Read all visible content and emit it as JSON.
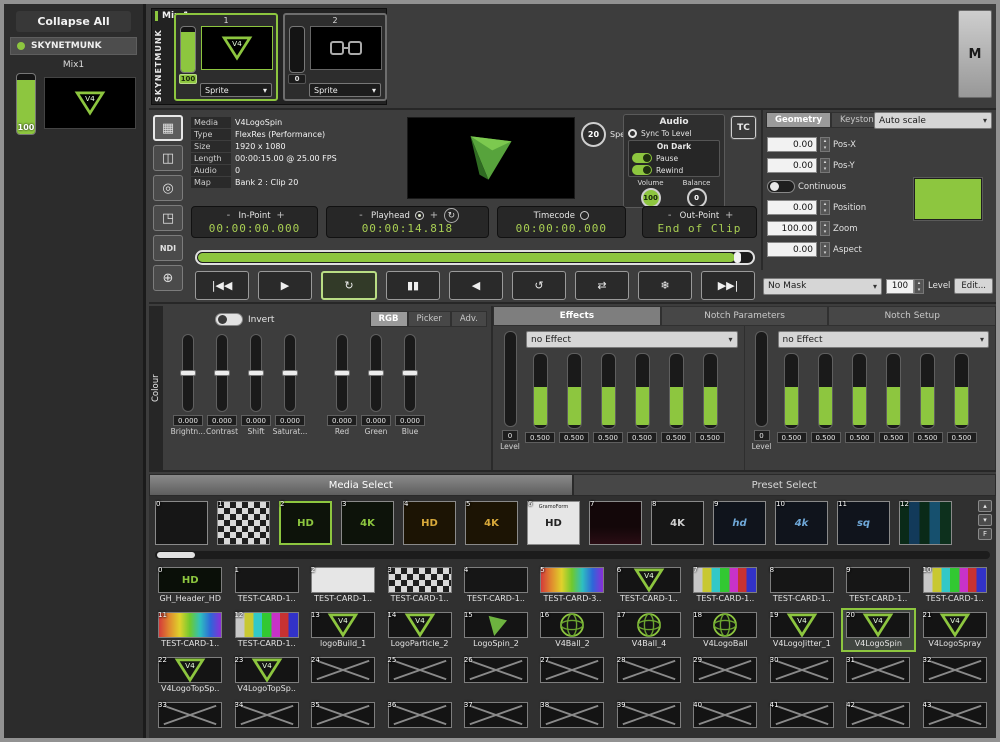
{
  "colors": {
    "accent": "#8dc63f",
    "timecode_text": "#a9cf53"
  },
  "sidebar": {
    "collapse_all": "Collapse All",
    "machine": "SKYNETMUNK",
    "mix": "Mix1",
    "fader": "100"
  },
  "mix_strip": {
    "title": "Mix 1",
    "machine": "SKYNETMUNK",
    "master": "M",
    "layers": [
      {
        "num": "1",
        "fader": "100",
        "type": "Sprite",
        "thumb": "v4",
        "selected": true
      },
      {
        "num": "2",
        "fader": "0",
        "type": "Sprite",
        "thumb": "clip",
        "selected": false
      }
    ]
  },
  "tools": [
    {
      "name": "viewer-grid",
      "glyph": "▦",
      "selected": true
    },
    {
      "name": "camera",
      "glyph": "◫",
      "selected": false
    },
    {
      "name": "record",
      "glyph": "◎",
      "selected": false
    },
    {
      "name": "fullscreen",
      "glyph": "◳",
      "selected": false
    },
    {
      "name": "ndi",
      "glyph": "NDI",
      "selected": false,
      "text": true
    },
    {
      "name": "sphere",
      "glyph": "⊕",
      "selected": false
    }
  ],
  "media_info": {
    "rows": [
      {
        "label": "Media",
        "value": "V4LogoSpin"
      },
      {
        "label": "Type",
        "value": "FlexRes (Performance)"
      },
      {
        "label": "Size",
        "value": "1920 x 1080"
      },
      {
        "label": "Length",
        "value": "00:00:15.00 @ 25.00 FPS"
      },
      {
        "label": "Audio",
        "value": "0"
      },
      {
        "label": "Map",
        "value": "Bank 2 : Clip 20"
      }
    ]
  },
  "playback": {
    "speed_value": "20",
    "speed_label": "Speed",
    "tc": "TC",
    "audio": {
      "title": "Audio",
      "sync": "Sync To Level",
      "on_dark": "On Dark",
      "pause": "Pause",
      "rewind": "Rewind",
      "volume_label": "Volume",
      "balance_label": "Balance",
      "volume": "100",
      "balance": "0"
    },
    "points": [
      {
        "name": "in",
        "label": "In-Point",
        "value": "00:00:00.000",
        "minus": true,
        "plus": true,
        "radio": false,
        "refresh": false
      },
      {
        "name": "playhead",
        "label": "Playhead",
        "value": "00:00:14.818",
        "minus": true,
        "plus": true,
        "radio": true,
        "refresh": true
      },
      {
        "name": "timecode",
        "label": "Timecode",
        "value": "00:00:00.000",
        "minus": false,
        "plus": false,
        "radio": true,
        "refresh": false
      },
      {
        "name": "out",
        "label": "Out-Point",
        "value": "End of Clip",
        "minus": true,
        "plus": true,
        "radio": false,
        "refresh": false
      }
    ],
    "transport": [
      {
        "name": "skip-start",
        "glyph": "|◀◀",
        "selected": false
      },
      {
        "name": "play",
        "glyph": "▶",
        "selected": false
      },
      {
        "name": "loop",
        "glyph": "↻",
        "selected": true
      },
      {
        "name": "pause",
        "glyph": "▮▮",
        "selected": false
      },
      {
        "name": "play-reverse",
        "glyph": "◀",
        "selected": false
      },
      {
        "name": "loop-reverse",
        "glyph": "↺",
        "selected": false
      },
      {
        "name": "bounce",
        "glyph": "⇄",
        "selected": false
      },
      {
        "name": "freeze",
        "glyph": "❄",
        "selected": false
      },
      {
        "name": "skip-end",
        "glyph": "▶▶|",
        "selected": false
      }
    ]
  },
  "geometry": {
    "tabs": [
      {
        "label": "Geometry",
        "active": true
      },
      {
        "label": "Keystone",
        "active": false
      }
    ],
    "scale_mode": "Auto scale",
    "fields": [
      {
        "type": "value",
        "value": "0.00",
        "label": "Pos-X"
      },
      {
        "type": "value",
        "value": "0.00",
        "label": "Pos-Y"
      },
      {
        "type": "toggle",
        "label": "Continuous"
      },
      {
        "type": "value",
        "value": "0.00",
        "label": "Position"
      },
      {
        "type": "value",
        "value": "100.00",
        "label": "Zoom"
      },
      {
        "type": "value",
        "value": "0.00",
        "label": "Aspect"
      }
    ],
    "mask": {
      "value": "No Mask",
      "level": "100",
      "level_label": "Level",
      "edit": "Edit..."
    }
  },
  "colour": {
    "title": "Colour",
    "invert": "Invert",
    "tabs": [
      {
        "label": "RGB",
        "active": true
      },
      {
        "label": "Picker",
        "active": false
      },
      {
        "label": "Adv.",
        "active": false
      }
    ],
    "sliders": [
      {
        "value": "0.000",
        "label": "Brightn..."
      },
      {
        "value": "0.000",
        "label": "Contrast"
      },
      {
        "value": "0.000",
        "label": "Shift"
      },
      {
        "value": "0.000",
        "label": "Saturat..."
      }
    ],
    "rgb": [
      {
        "value": "0.000",
        "label": "Red"
      },
      {
        "value": "0.000",
        "label": "Green"
      },
      {
        "value": "0.000",
        "label": "Blue"
      }
    ]
  },
  "effects": {
    "tabs": [
      {
        "label": "Effects",
        "active": true
      },
      {
        "label": "Notch Parameters",
        "active": false
      },
      {
        "label": "Notch Setup",
        "active": false
      }
    ],
    "banks": [
      {
        "effect": "no Effect",
        "level": "0",
        "level_label": "Level",
        "faders": [
          "0.500",
          "0.500",
          "0.500",
          "0.500",
          "0.500",
          "0.500"
        ]
      },
      {
        "effect": "no Effect",
        "level": "0",
        "level_label": "Level",
        "faders": [
          "0.500",
          "0.500",
          "0.500",
          "0.500",
          "0.500",
          "0.500"
        ]
      }
    ]
  },
  "library": {
    "tabs": [
      {
        "label": "Media Select",
        "active": true
      },
      {
        "label": "Preset Select",
        "active": false
      }
    ],
    "banks": [
      {
        "num": "0",
        "thumb": "dark",
        "text": ""
      },
      {
        "num": "1",
        "thumb": "checker",
        "text": ""
      },
      {
        "num": "2",
        "thumb": "wire",
        "text": "HD",
        "selected": true
      },
      {
        "num": "3",
        "thumb": "wire",
        "text": "4K"
      },
      {
        "num": "4",
        "thumb": "gold",
        "text": "HD"
      },
      {
        "num": "5",
        "thumb": "gold",
        "text": "4K"
      },
      {
        "num": "6",
        "thumb": "white",
        "text": "HD",
        "sub": "GramoForm"
      },
      {
        "num": "7",
        "thumb": "pink",
        "text": ""
      },
      {
        "num": "8",
        "thumb": "dark",
        "text": "4K"
      },
      {
        "num": "9",
        "thumb": "blue",
        "text": "hd"
      },
      {
        "num": "10",
        "thumb": "blue",
        "text": "4k"
      },
      {
        "num": "11",
        "thumb": "blue",
        "text": "sq"
      },
      {
        "num": "12",
        "thumb": "matrix",
        "text": ""
      }
    ],
    "clips": [
      {
        "num": "0",
        "label": "GH_Header_HD",
        "thumb": "hdgreen",
        "text": "HD"
      },
      {
        "num": "1",
        "label": "TEST-CARD-1..",
        "thumb": "dark"
      },
      {
        "num": "2",
        "label": "TEST-CARD-1..",
        "thumb": "white"
      },
      {
        "num": "3",
        "label": "TEST-CARD-1..",
        "thumb": "checker"
      },
      {
        "num": "4",
        "label": "TEST-CARD-1..",
        "thumb": "dark"
      },
      {
        "num": "5",
        "label": "TEST-CARD-3..",
        "thumb": "rainbow"
      },
      {
        "num": "6",
        "label": "TEST-CARD-1..",
        "thumb": "v4"
      },
      {
        "num": "7",
        "label": "TEST-CARD-1..",
        "thumb": "colorbars"
      },
      {
        "num": "8",
        "label": "TEST-CARD-1..",
        "thumb": "dark"
      },
      {
        "num": "9",
        "label": "TEST-CARD-1..",
        "thumb": "dark"
      },
      {
        "num": "10",
        "label": "TEST-CARD-1..",
        "thumb": "colorbars"
      },
      {
        "num": "11",
        "label": "TEST-CARD-1..",
        "thumb": "rainbow"
      },
      {
        "num": "12",
        "label": "TEST-CARD-1..",
        "thumb": "colorbars"
      },
      {
        "num": "13",
        "label": "logoBuild_1",
        "thumb": "v4"
      },
      {
        "num": "14",
        "label": "LogoParticle_2",
        "thumb": "v4"
      },
      {
        "num": "15",
        "label": "LogoSpin_2",
        "thumb": "tri"
      },
      {
        "num": "16",
        "label": "V4Ball_2",
        "thumb": "ball"
      },
      {
        "num": "17",
        "label": "V4Ball_4",
        "thumb": "ball"
      },
      {
        "num": "18",
        "label": "V4LogoBall",
        "thumb": "ball"
      },
      {
        "num": "19",
        "label": "V4LogoJitter_1",
        "thumb": "v4"
      },
      {
        "num": "20",
        "label": "V4LogoSpin",
        "thumb": "v4",
        "selected": true
      },
      {
        "num": "21",
        "label": "V4LogoSpray",
        "thumb": "v4"
      },
      {
        "num": "22",
        "label": "V4LogoTopSp..",
        "thumb": "v4"
      },
      {
        "num": "23",
        "label": "V4LogoTopSp..",
        "thumb": "v4"
      },
      {
        "num": "24",
        "label": "",
        "thumb": "empty"
      },
      {
        "num": "25",
        "label": "",
        "thumb": "empty"
      },
      {
        "num": "26",
        "label": "",
        "thumb": "empty"
      },
      {
        "num": "27",
        "label": "",
        "thumb": "empty"
      },
      {
        "num": "28",
        "label": "",
        "thumb": "empty"
      },
      {
        "num": "29",
        "label": "",
        "thumb": "empty"
      },
      {
        "num": "30",
        "label": "",
        "thumb": "empty"
      },
      {
        "num": "31",
        "label": "",
        "thumb": "empty"
      },
      {
        "num": "32",
        "label": "",
        "thumb": "empty"
      },
      {
        "num": "33",
        "label": "",
        "thumb": "empty"
      },
      {
        "num": "34",
        "label": "",
        "thumb": "empty"
      },
      {
        "num": "35",
        "label": "",
        "thumb": "empty"
      },
      {
        "num": "36",
        "label": "",
        "thumb": "empty"
      },
      {
        "num": "37",
        "label": "",
        "thumb": "empty"
      },
      {
        "num": "38",
        "label": "",
        "thumb": "empty"
      },
      {
        "num": "39",
        "label": "",
        "thumb": "empty"
      },
      {
        "num": "40",
        "label": "",
        "thumb": "empty"
      },
      {
        "num": "41",
        "label": "",
        "thumb": "empty"
      },
      {
        "num": "42",
        "label": "",
        "thumb": "empty"
      },
      {
        "num": "43",
        "label": "",
        "thumb": "empty"
      }
    ],
    "bank_ctrls": [
      "▴",
      "▾",
      "F"
    ]
  }
}
